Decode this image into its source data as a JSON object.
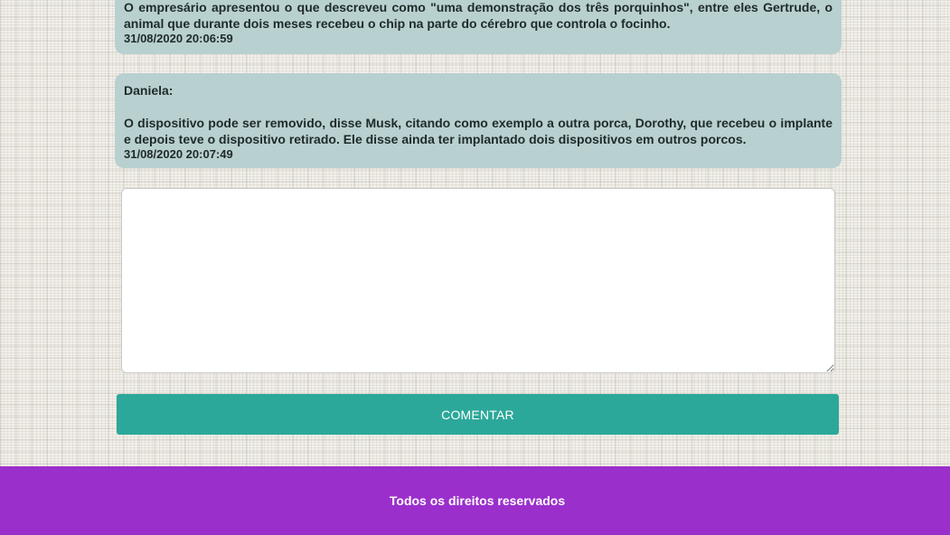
{
  "comments": [
    {
      "author": "",
      "text": "O empresário apresentou o que descreveu como \"uma demonstração dos três porquinhos\", entre eles Gertrude, o animal que durante dois meses recebeu o chip na parte do cérebro que controla o focinho.",
      "timestamp": "31/08/2020 20:06:59"
    },
    {
      "author": "Daniela:",
      "text": "O dispositivo pode ser removido, disse Musk, citando como exemplo a outra porca, Dorothy, que recebeu o implante e depois teve o dispositivo retirado. Ele disse ainda ter implantado dois dispositivos em outros porcos.",
      "timestamp": "31/08/2020 20:07:49"
    }
  ],
  "form": {
    "comment_value": "",
    "submit_label": "COMENTAR"
  },
  "footer": {
    "text": "Todos os direitos reservados",
    "background_color": "#9b2fcc"
  },
  "colors": {
    "comment_bubble": "#b9d0d0",
    "button": "#2ca89a"
  }
}
